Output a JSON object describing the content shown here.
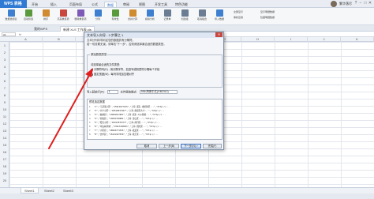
{
  "app": {
    "brand": "WPS 表格",
    "tabs": [
      "开始",
      "插入",
      "页面布局",
      "公式",
      "数据",
      "审阅",
      "视图",
      "开发工具",
      "特色功能"
    ],
    "active_tab": "数据",
    "user_name": "繁华落尽",
    "window_controls": [
      "?",
      "−",
      "□",
      "✕"
    ]
  },
  "ribbon": {
    "buttons": [
      {
        "label": "数据透视表",
        "icon": "pivot-table-icon",
        "color": "#3f7fd0"
      },
      {
        "label": "自动筛选",
        "icon": "filter-icon",
        "color": "#5a9a3c"
      },
      {
        "label": "排序",
        "icon": "sort-icon",
        "color": "#d08a2f"
      },
      {
        "label": "高亮重复项",
        "icon": "highlight-icon",
        "color": "#c9473c"
      },
      {
        "label": "删除重复项",
        "icon": "remove-duplicates-icon",
        "color": "#7d5ab8"
      },
      {
        "label": "分列",
        "icon": "split-column-icon",
        "color": "#3f7fd0"
      },
      {
        "label": "有效性",
        "icon": "validation-icon",
        "color": "#5a9a3c"
      },
      {
        "label": "合并计算",
        "icon": "consolidate-icon",
        "color": "#d08a2f"
      },
      {
        "label": "模拟分析",
        "icon": "what-if-icon",
        "color": "#3f7fd0"
      },
      {
        "label": "记录单",
        "icon": "form-icon",
        "color": "#6b7d93"
      },
      {
        "label": "创建组",
        "icon": "group-icon",
        "color": "#6b7d93"
      },
      {
        "label": "取消组合",
        "icon": "ungroup-icon",
        "color": "#6b7d93"
      },
      {
        "label": "导入数据",
        "icon": "import-data-icon",
        "color": "#3f7fd0"
      }
    ],
    "small": [
      "全部显示",
      "重新应用",
      "显示明细数据",
      "隐藏明细数据"
    ]
  },
  "doc_tabs": [
    "我的WPS",
    "新建 XLS 工作表.xls"
  ],
  "namebox": "A1",
  "fx": "fx",
  "columns": [
    "A",
    "B",
    "C",
    "D",
    "E",
    "F",
    "G",
    "H",
    "I",
    "J",
    "K"
  ],
  "rows": [
    "1",
    "2",
    "3",
    "4",
    "5",
    "6",
    "7",
    "8",
    "9",
    "10",
    "11",
    "12",
    "13",
    "14",
    "15",
    "16",
    "17",
    "18",
    "19",
    "20"
  ],
  "sheets": [
    "Sheet1",
    "Sheet2",
    "Sheet3"
  ],
  "dialog": {
    "title": "文本导入向导 - 3 步骤之 1",
    "description_1": "文本分列向导判定您的数据具有分隔符。",
    "description_2": "若一切设置无误，请单击“下一步”，否则请选择最合适的数据类型。",
    "group_title": "原始数据类型",
    "group_sub": "请选择最合适的文件类型:",
    "radio_1": "分隔符号(D) - 用分隔字符，如逗号或制表符分隔每个字段",
    "radio_2": "固定宽度(W) - 每列字段加空格对齐",
    "start_row_label": "导入起始行(R):",
    "start_row_value": "1",
    "encoding_label": "文件原始格式:",
    "encoding_value": "936:简体中文(GB2312)",
    "preview_title": "预览选定数据",
    "preview_rows": [
      {
        "n": "1",
        "text": "\"1\",\"王某某小区\",\"15911677145\",\"上海·浦东·金桥新区...\",\"http://..."
      },
      {
        "n": "2",
        "text": "\"2\",\"大宁小区\",\"18516037447\",\"上海·静安区大宁...\",\"http://..."
      },
      {
        "n": "3",
        "text": "\"3\",\"福禄居\",\"13816617007\",\"上海·浦东·川沙新镇...\",\"http://..."
      },
      {
        "n": "4",
        "text": "\"4\",\"家和苑\",\"13601726681\",\"上海·宝山区...\",\"http://..."
      },
      {
        "n": "5",
        "text": "\"5\",\"阳光小区\",\"18317033773\",\"上海·闵行区...\",\"http://..."
      },
      {
        "n": "6",
        "text": "\"6\",\"中远两湾城\",\"13917228031\",\"上海·普陀区...\",\"http://..."
      },
      {
        "n": "7",
        "text": "\"7\",\"小区名\",\"18918771345\",\"上海·嘉定区...\",\"http://..."
      },
      {
        "n": "8",
        "text": "\"8\",\"文华苑\",\"15221107539\",\"上海·徐汇区...\",\"http://..."
      }
    ],
    "buttons": {
      "cancel": "取消",
      "prev": "上一步(B)",
      "next": "下一步(N) >",
      "finish": "完成(F)"
    }
  }
}
